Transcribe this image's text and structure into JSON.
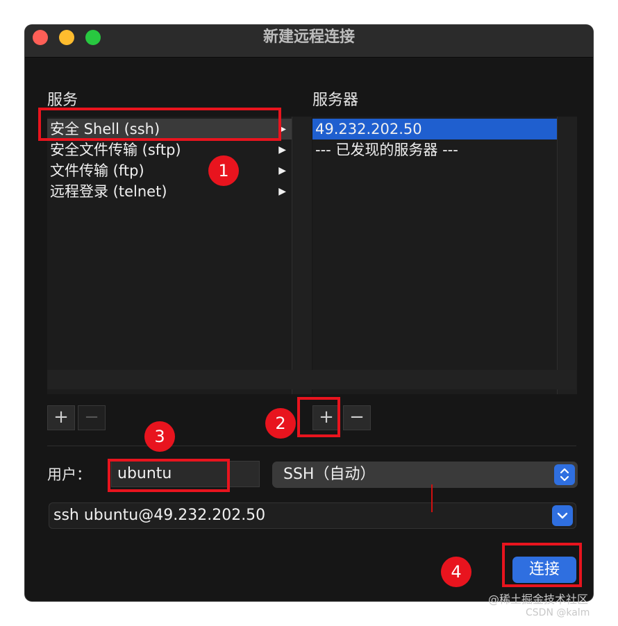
{
  "window": {
    "title": "新建远程连接"
  },
  "services": {
    "label": "服务",
    "items": [
      {
        "label": "安全 Shell (ssh)",
        "selected": true
      },
      {
        "label": "安全文件传输 (sftp)",
        "selected": false
      },
      {
        "label": "文件传输 (ftp)",
        "selected": false
      },
      {
        "label": "远程登录 (telnet)",
        "selected": false
      }
    ],
    "arrow": "▶",
    "add_label": "+",
    "remove_label": "−"
  },
  "servers": {
    "label": "服务器",
    "items": [
      {
        "label": "49.232.202.50",
        "selected": true
      },
      {
        "label": "--- 已发现的服务器 ---",
        "selected": false
      }
    ],
    "add_label": "+",
    "remove_label": "−"
  },
  "user": {
    "label": "用户：",
    "value": "ubuntu"
  },
  "protocol_select": {
    "value": "SSH（自动）"
  },
  "command_combo": {
    "value": "ssh ubuntu@49.232.202.50"
  },
  "connect_button": {
    "label": "连接"
  },
  "annotations": [
    "1",
    "2",
    "3",
    "4"
  ],
  "watermark": {
    "line1": "@稀土掘金技术社区",
    "line2": "CSDN @kalm"
  },
  "colors": {
    "accent": "#2f6fe0",
    "annotation": "#e8141e",
    "selection": "#1f5fcf"
  }
}
